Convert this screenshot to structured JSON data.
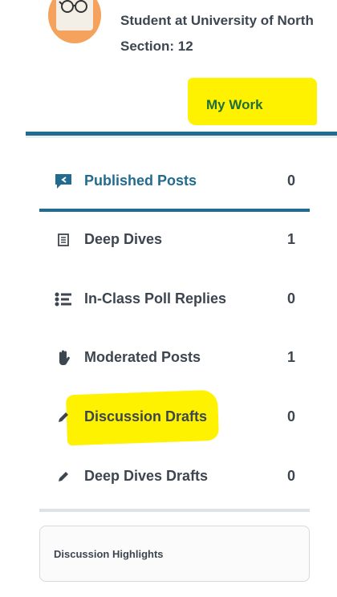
{
  "profile": {
    "subtitle": "Student at University of North",
    "section": "Section: 12"
  },
  "tabs": {
    "active_label": "My Work"
  },
  "colors": {
    "accent": "#236b8e",
    "highlight": "#fff200",
    "text": "#3d4650",
    "tab_text": "#1f6e3a"
  },
  "items": [
    {
      "label": "Published Posts",
      "count": "0",
      "icon": "chat-bubble-icon",
      "active": true
    },
    {
      "label": "Deep Dives",
      "count": "1",
      "icon": "document-icon"
    },
    {
      "label": "In-Class Poll Replies",
      "count": "0",
      "icon": "list-icon"
    },
    {
      "label": "Moderated Posts",
      "count": "1",
      "icon": "hand-icon"
    },
    {
      "label": "Discussion Drafts",
      "count": "0",
      "icon": "pencil-icon",
      "highlighted": true
    },
    {
      "label": "Deep Dives Drafts",
      "count": "0",
      "icon": "pencil-icon"
    }
  ],
  "card": {
    "title": "Discussion Highlights"
  }
}
